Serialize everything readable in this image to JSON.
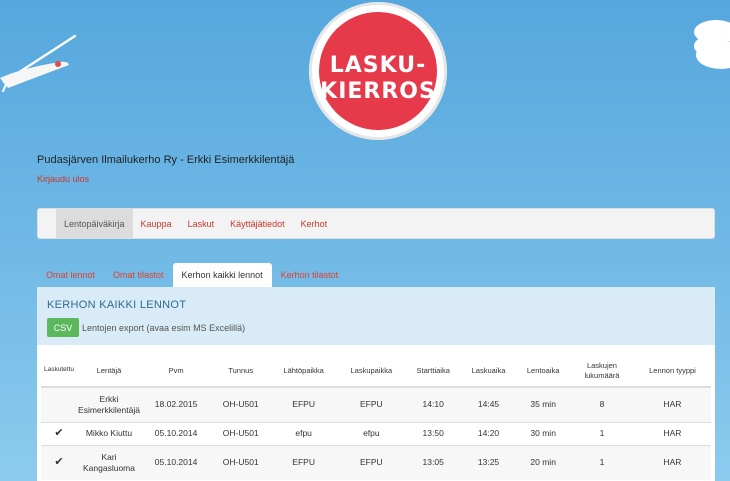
{
  "logo": {
    "line1": "LASKU-",
    "line2": "KIERROS"
  },
  "header": {
    "club_title": "Pudasjärven Ilmailukerho Ry - Erkki Esimerkkilentäjä",
    "logout": "Kirjaudu ulos"
  },
  "nav": {
    "items": [
      "Lentopäiväkirja",
      "Kauppa",
      "Laskut",
      "Käyttäjätiedot",
      "Kerhot"
    ],
    "active": "Lentopäiväkirja"
  },
  "tabs": {
    "items": [
      "Omat lennot",
      "Omat tilastot",
      "Kerhon kaikki lennot",
      "Kerhon tilastot"
    ],
    "active": "Kerhon kaikki lennot"
  },
  "panel": {
    "title": "KERHON KAIKKI LENNOT",
    "csv_label": "CSV",
    "export_text": "Lentojen export (avaa esim MS Excelillä)"
  },
  "table": {
    "headers": [
      "Laskutettu",
      "Lentäjä",
      "Pvm",
      "Tunnus",
      "Lähtöpaikka",
      "Laskupaikka",
      "Starttiaika",
      "Laskuaika",
      "Lentoaika",
      "Laskujen lukumäärä",
      "Lennon tyyppi"
    ],
    "rows": [
      [
        "",
        "Erkki Esimerkkilentäjä",
        "18.02.2015",
        "OH-U501",
        "EFPU",
        "EFPU",
        "14:10",
        "14:45",
        "35 min",
        "8",
        "HAR"
      ],
      [
        "✔",
        "Mikko Kiuttu",
        "05.10.2014",
        "OH-U501",
        "efpu",
        "efpu",
        "13:50",
        "14:20",
        "30 min",
        "1",
        "HAR"
      ],
      [
        "✔",
        "Kari Kangasluoma",
        "05.10.2014",
        "OH-U501",
        "EFPU",
        "EFPU",
        "13:05",
        "13:25",
        "20 min",
        "1",
        "HAR"
      ]
    ]
  },
  "colors": {
    "accent_red": "#c8392b",
    "panel_blue": "#d8ebf7",
    "csv_green": "#5cb85c",
    "sky": "#6ab5e4"
  },
  "icons": {
    "decor_left": "glider-icon",
    "decor_right": "cloud-icon",
    "logo_plane": "airplane-icon",
    "check": "checkmark-icon"
  }
}
